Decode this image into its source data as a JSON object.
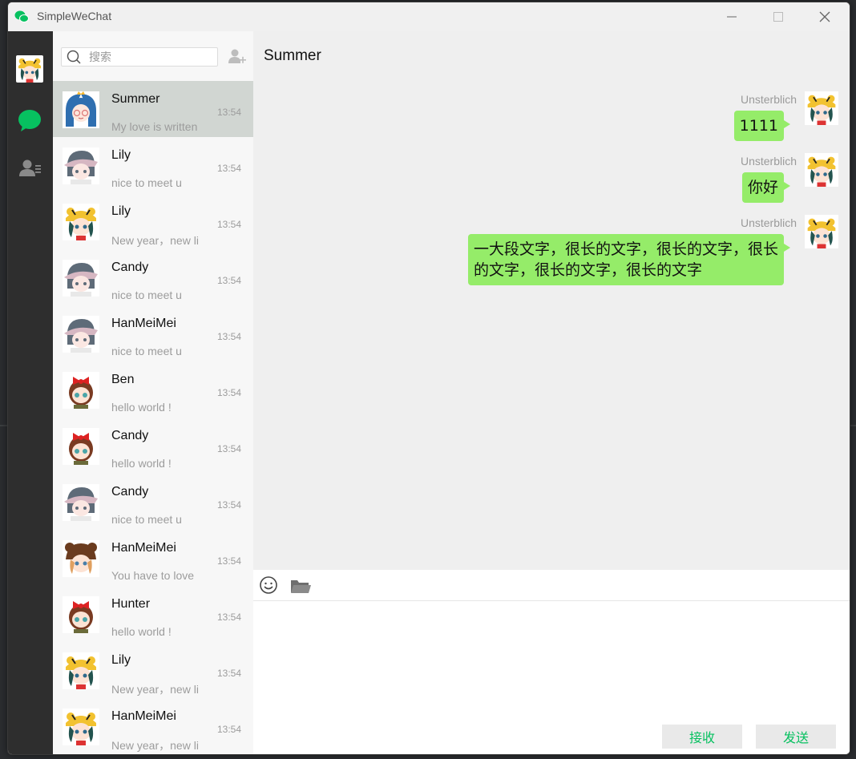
{
  "window": {
    "title": "SimpleWeChat"
  },
  "search": {
    "placeholder": "搜索"
  },
  "sessions": [
    {
      "name": "Summer",
      "preview": "My love is written",
      "time": "13:54",
      "avatar": "blue-hood-avatar"
    },
    {
      "name": "Lily",
      "preview": "nice to meet u",
      "time": "13:54",
      "avatar": "grey-hair-avatar"
    },
    {
      "name": "Lily",
      "preview": "New year，new li",
      "time": "13:54",
      "avatar": "tiger-hat-avatar"
    },
    {
      "name": "Candy",
      "preview": "nice to meet u",
      "time": "13:54",
      "avatar": "grey-hair-avatar"
    },
    {
      "name": "HanMeiMei",
      "preview": "nice to meet u",
      "time": "13:54",
      "avatar": "grey-hair-avatar"
    },
    {
      "name": "Ben",
      "preview": "hello world !",
      "time": "13:54",
      "avatar": "red-bow-avatar"
    },
    {
      "name": "Candy",
      "preview": "hello world !",
      "time": "13:54",
      "avatar": "red-bow-avatar"
    },
    {
      "name": "Candy",
      "preview": "nice to meet u",
      "time": "13:54",
      "avatar": "grey-hair-avatar"
    },
    {
      "name": "HanMeiMei",
      "preview": "You have to love",
      "time": "13:54",
      "avatar": "bear-hat-avatar"
    },
    {
      "name": "Hunter",
      "preview": "hello world !",
      "time": "13:54",
      "avatar": "red-bow-avatar"
    },
    {
      "name": "Lily",
      "preview": "New year，new li",
      "time": "13:54",
      "avatar": "tiger-hat-avatar"
    },
    {
      "name": "HanMeiMei",
      "preview": "New year，new li",
      "time": "13:54",
      "avatar": "tiger-hat-avatar"
    }
  ],
  "chat": {
    "title": "Summer",
    "messages": [
      {
        "sender": "Unsterblich",
        "text": "1111"
      },
      {
        "sender": "Unsterblich",
        "text": "你好"
      },
      {
        "sender": "Unsterblich",
        "text": "一大段文字，很长的文字，很长的文字，很长的文字，很长的文字，很长的文字"
      }
    ]
  },
  "buttons": {
    "receive": "接收",
    "send": "发送"
  },
  "colors": {
    "accent": "#07c160",
    "bubble": "#95ec69",
    "sidebar": "#2e2e2e",
    "active_session": "#d1d6d2"
  }
}
